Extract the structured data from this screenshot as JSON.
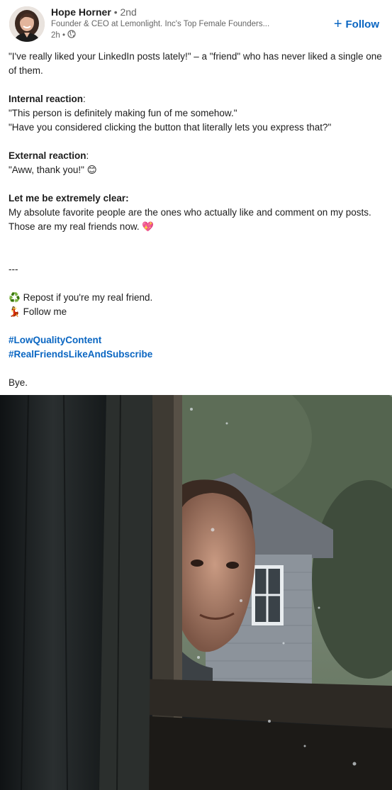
{
  "author": {
    "name": "Hope Horner",
    "degree": "• 2nd",
    "headline": "Founder & CEO at Lemonlight. Inc's Top Female Founders...",
    "time": "2h •",
    "visibility_icon": "globe-icon"
  },
  "follow_button": {
    "icon": "plus-icon",
    "label": "Follow"
  },
  "post": {
    "intro": "\"I've really liked your LinkedIn posts lately!\" –  a \"friend\" who has never liked a single one of them.",
    "internal_heading": "Internal reaction",
    "internal_colon": ":",
    "internal_line_1": "\"This person is definitely making fun of me somehow.\"",
    "internal_line_2": "\"Have you considered clicking the button that literally lets you express that?\"",
    "external_heading": "External reaction",
    "external_colon": ":",
    "external_line": "\"Aww, thank you!\"",
    "external_emoji": "😊",
    "clear_heading": "Let me be extremely clear:",
    "clear_body": "My absolute favorite people are the ones who actually like and comment on my posts. Those are my real friends now.",
    "clear_emoji": "💖",
    "divider": "---",
    "repost_emoji": "♻️",
    "repost_text": "Repost if you're my real friend.",
    "follow_emoji": "💃",
    "follow_text": "Follow me",
    "hashtag_1": "#LowQualityContent",
    "hashtag_2": "#RealFriendsLikeAndSubscribe",
    "signoff": "Bye."
  },
  "colors": {
    "link_blue": "#0a66c2",
    "text": "#1d1d1d",
    "meta": "#666666"
  }
}
